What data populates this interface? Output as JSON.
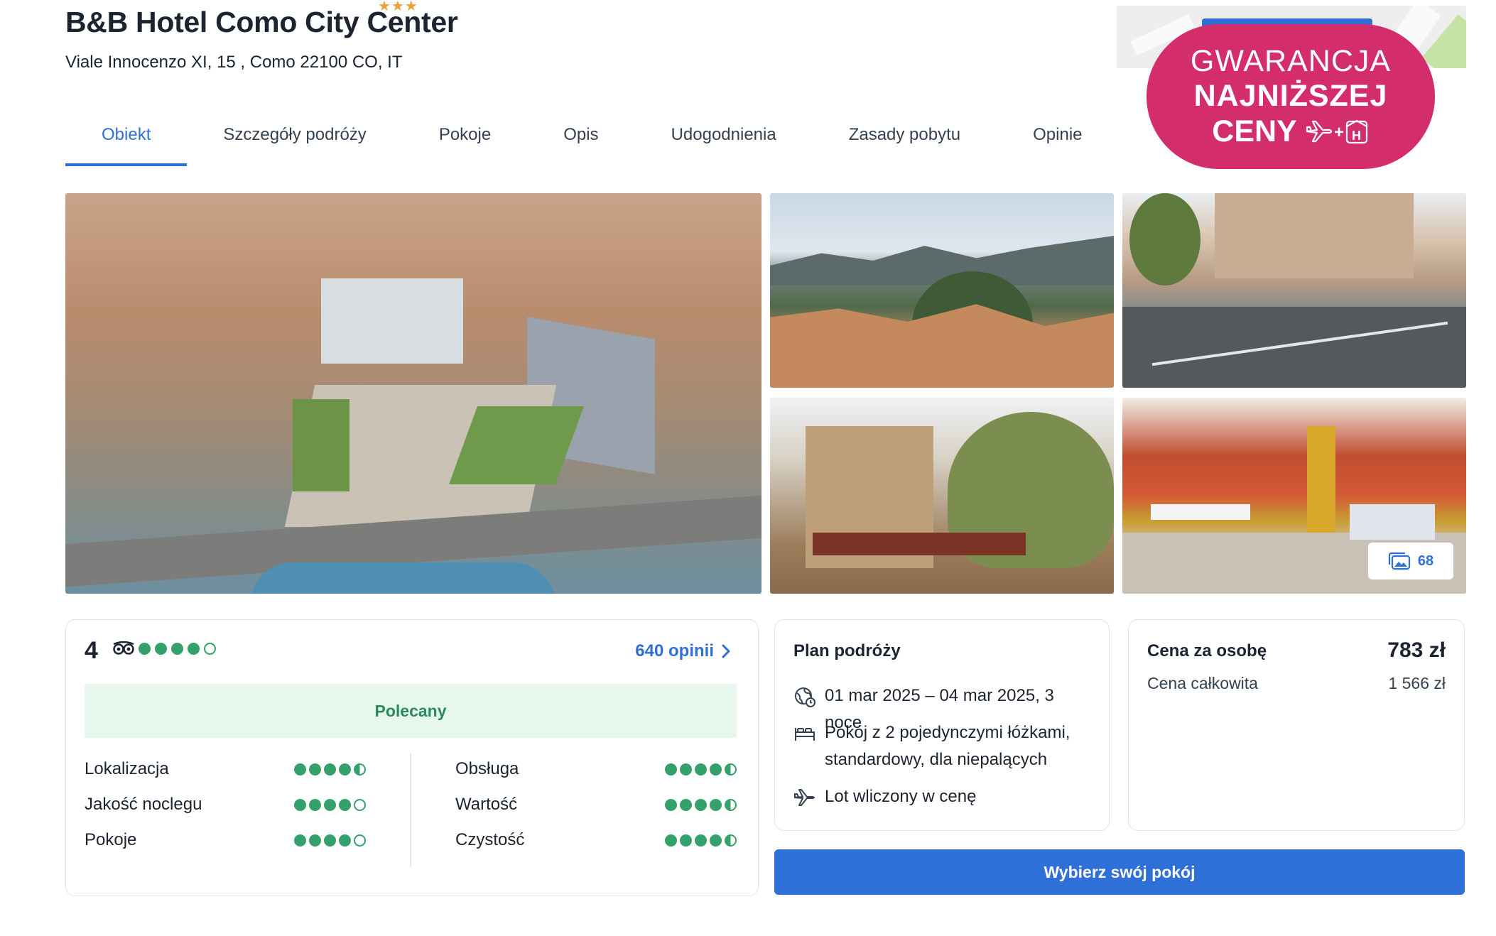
{
  "hotel": {
    "name": "B&B Hotel Como City Center",
    "stars": "★★★",
    "address": "Viale Innocenzo XI, 15 , Como 22100 CO, IT"
  },
  "tabs": [
    {
      "label": "Obiekt",
      "active": true
    },
    {
      "label": "Szczegóły podróży"
    },
    {
      "label": "Pokoje"
    },
    {
      "label": "Opis"
    },
    {
      "label": "Udogodnienia"
    },
    {
      "label": "Zasady pobytu"
    },
    {
      "label": "Opinie"
    }
  ],
  "badge": {
    "line1": "GWARANCJA",
    "line2": "NAJNIŻSZEJ",
    "line3": "CENY",
    "icon_plus": "+",
    "icon_h": "H",
    "color": "#d32d6c"
  },
  "gallery": {
    "photo_count": "68",
    "icon": "gallery-icon"
  },
  "rating": {
    "score": "4",
    "reviews_link": "640 opinii",
    "recommended": "Polecany",
    "categories": [
      {
        "label": "Lokalizacja",
        "dots": [
          1,
          1,
          1,
          1,
          0.5
        ]
      },
      {
        "label": "Jakość noclegu",
        "dots": [
          1,
          1,
          1,
          1,
          0
        ]
      },
      {
        "label": "Pokoje",
        "dots": [
          1,
          1,
          1,
          1,
          0
        ]
      },
      {
        "label": "Obsługa",
        "dots": [
          1,
          1,
          1,
          1,
          0.5
        ]
      },
      {
        "label": "Wartość",
        "dots": [
          1,
          1,
          1,
          1,
          0.5
        ]
      },
      {
        "label": "Czystość",
        "dots": [
          1,
          1,
          1,
          1,
          0.5
        ]
      }
    ]
  },
  "plan": {
    "title": "Plan podróży",
    "dates": "01 mar 2025 – 04 mar 2025, 3 noce",
    "room": "Pokój z 2 pojedynczymi łóżkami, standardowy, dla niepalących",
    "flight": "Lot wliczony w cenę"
  },
  "price": {
    "per_person_label": "Cena za osobę",
    "per_person_value": "783 zł",
    "total_label": "Cena całkowita",
    "total_value": "1 566 zł"
  },
  "cta": {
    "label": "Wybierz swój pokój",
    "color": "#2f6fd8"
  }
}
